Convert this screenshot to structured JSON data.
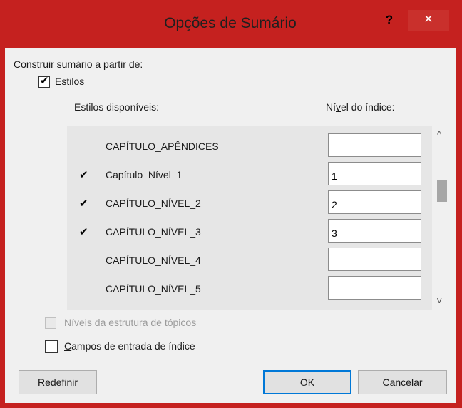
{
  "dialog": {
    "title": "Opções de Sumário",
    "help_label": "?",
    "close_label": "✕"
  },
  "build_from": {
    "label": "Construir sumário a partir de:"
  },
  "styles_option": {
    "checked": true,
    "label_accel": "E",
    "label_rest": "stilos"
  },
  "styles_header": {
    "available_label": "Estilos disponíveis:",
    "level_label_pre": "Ní",
    "level_label_accel": "v",
    "level_label_post": "el do índice:"
  },
  "styles": [
    {
      "name": "CAPÍTULO_APÊNDICES",
      "checked": false,
      "level": ""
    },
    {
      "name": "Capítulo_Nível_1",
      "checked": true,
      "level": "1"
    },
    {
      "name": "CAPÍTULO_NÍVEL_2",
      "checked": true,
      "level": "2"
    },
    {
      "name": "CAPÍTULO_NÍVEL_3",
      "checked": true,
      "level": "3"
    },
    {
      "name": "CAPÍTULO_NÍVEL_4",
      "checked": false,
      "level": ""
    },
    {
      "name": "CAPÍTULO_NÍVEL_5",
      "checked": false,
      "level": ""
    }
  ],
  "check_glyph": "✔",
  "scroll": {
    "up_glyph": "^",
    "down_glyph": "v",
    "position_fraction": 0.3
  },
  "outline_levels": {
    "label": "Níveis da estrutura de tópicos",
    "checked": false,
    "disabled": true
  },
  "index_fields": {
    "checked": false,
    "label_accel": "C",
    "label_rest": "ampos de entrada de índice"
  },
  "buttons": {
    "reset_accel": "R",
    "reset_rest": "edefinir",
    "ok": "OK",
    "cancel": "Cancelar"
  }
}
